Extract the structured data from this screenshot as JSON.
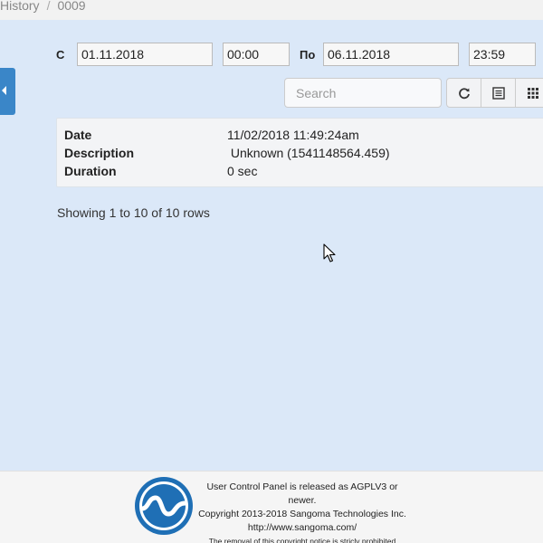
{
  "breadcrumb": {
    "items": [
      "History",
      "0009"
    ]
  },
  "filters": {
    "from_label": "С",
    "from_date": "01.11.2018",
    "from_time": "00:00",
    "to_label": "По",
    "to_date": "06.11.2018",
    "to_time": "23:59"
  },
  "search": {
    "placeholder": "Search"
  },
  "toolbar": {
    "icons": [
      "refresh-icon",
      "list-view-icon",
      "grid-columns-icon"
    ]
  },
  "detail": {
    "rows": [
      {
        "key": "Date",
        "value": "11/02/2018 11:49:24am"
      },
      {
        "key": "Description",
        "value": " Unknown (1541148564.459)"
      },
      {
        "key": "Duration",
        "value": "0 sec"
      }
    ]
  },
  "pagination": {
    "summary": "Showing 1 to 10 of 10 rows"
  },
  "footer": {
    "line1": "User Control Panel is released as AGPLV3 or newer.",
    "line2": "Copyright 2013-2018 Sangoma Technologies Inc.",
    "line3": "http://www.sangoma.com/",
    "line4": "The removal of this copyright notice is stricly prohibited"
  },
  "colors": {
    "accent": "#3a86c8",
    "background": "#dbe8f8",
    "logo": "#1f6fb5"
  }
}
